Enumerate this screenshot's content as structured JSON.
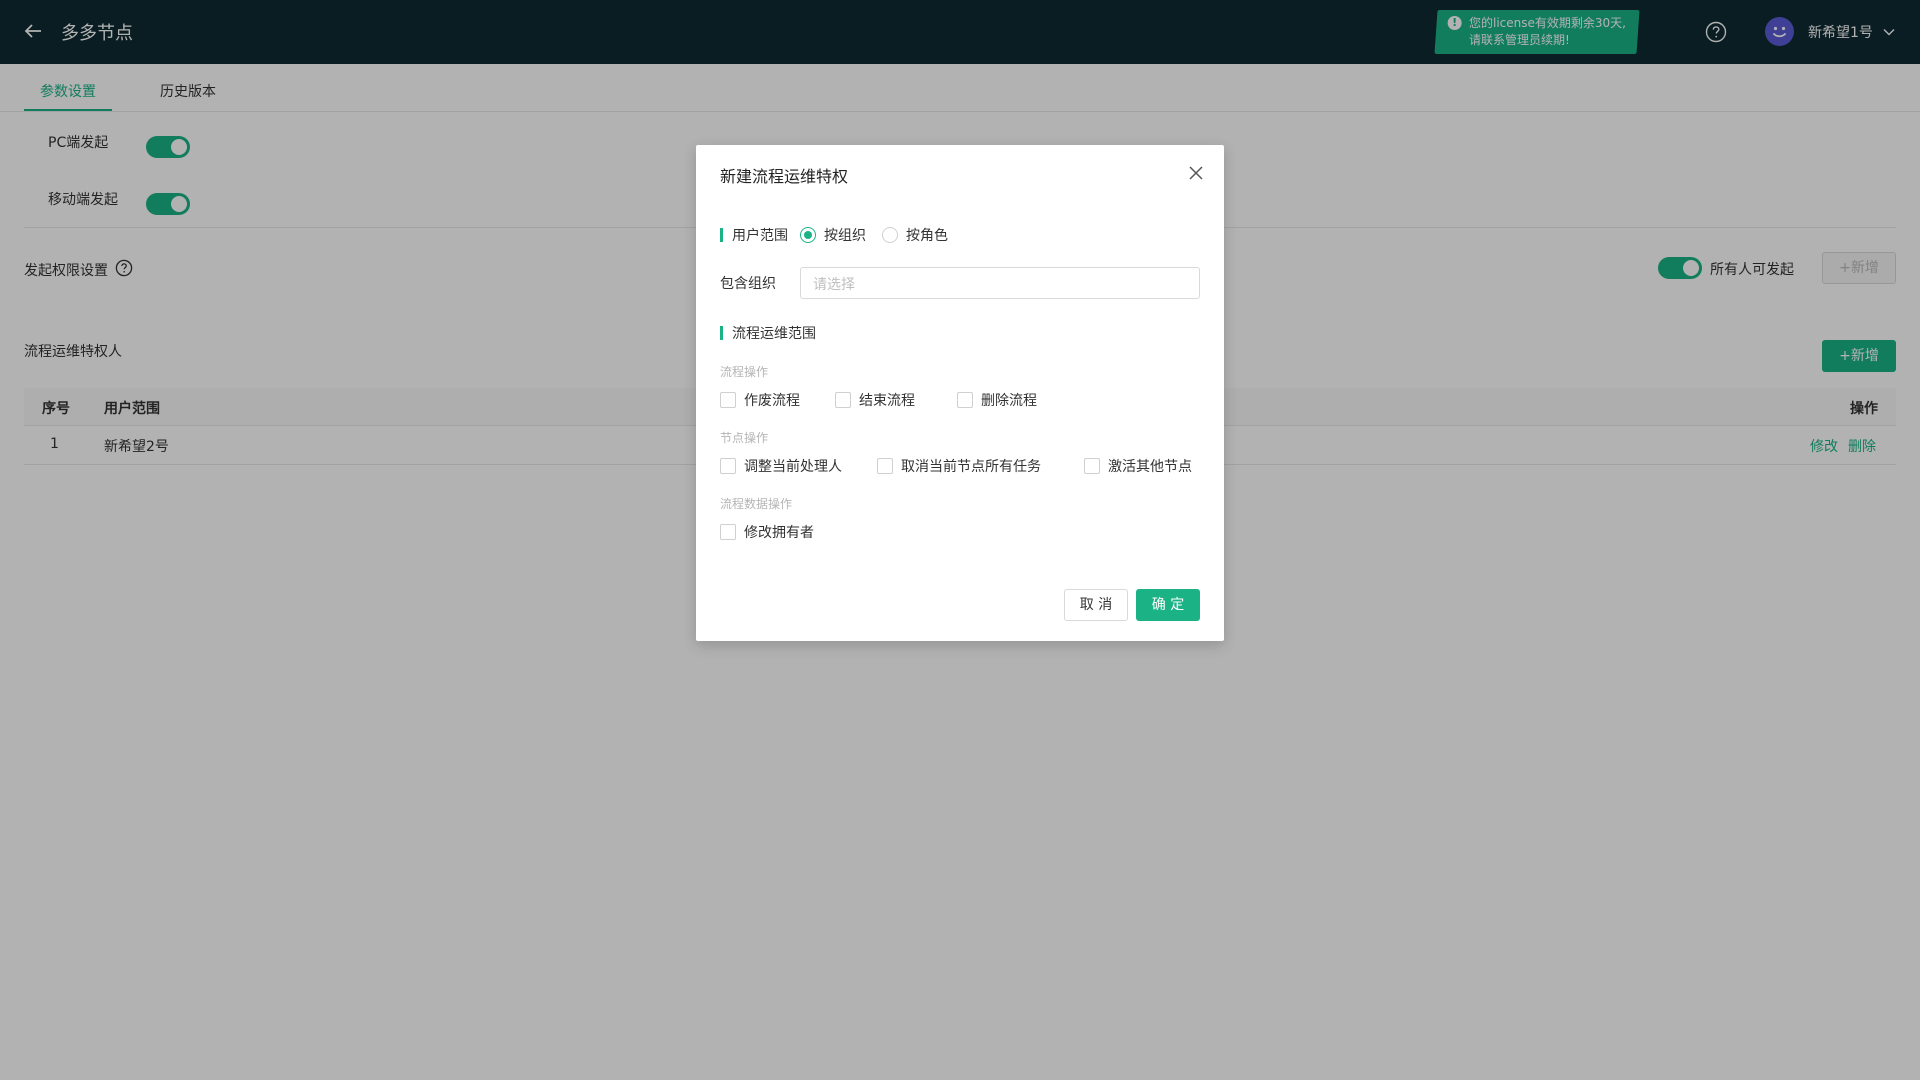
{
  "header": {
    "title": "多多节点",
    "license_notice_line1": "您的license有效期剩余30天,",
    "license_notice_line2": "请联系管理员续期!",
    "user_name": "新希望1号"
  },
  "tabs": [
    {
      "label": "参数设置",
      "active": true
    },
    {
      "label": "历史版本",
      "active": false
    }
  ],
  "settings": {
    "pc_launch_label": "PC端发起",
    "mobile_launch_label": "移动端发起",
    "permission_title": "发起权限设置",
    "everyone_can_launch_label": "所有人可发起",
    "add_label": "+新增"
  },
  "maintainers": {
    "title": "流程运维特权人",
    "add_label": "+新增",
    "columns": [
      "序号",
      "用户范围",
      "操作"
    ],
    "rows": [
      {
        "index": "1",
        "scope": "新希望2号",
        "edit": "修改",
        "delete": "删除"
      }
    ]
  },
  "modal": {
    "title": "新建流程运维特权",
    "user_scope_label": "用户范围",
    "radio_options": [
      "按组织",
      "按角色"
    ],
    "selected_radio": "按组织",
    "include_org_label": "包含组织",
    "include_org_placeholder": "请选择",
    "scope_section_label": "流程运维范围",
    "groups": [
      {
        "caption": "流程操作",
        "options": [
          "作废流程",
          "结束流程",
          "删除流程"
        ]
      },
      {
        "caption": "节点操作",
        "options": [
          "调整当前处理人",
          "取消当前节点所有任务",
          "激活其他节点"
        ]
      },
      {
        "caption": "流程数据操作",
        "options": [
          "修改拥有者"
        ]
      }
    ],
    "cancel_label": "取 消",
    "ok_label": "确 定"
  },
  "colors": {
    "accent": "#1bb386",
    "header_bg": "#0e2a33"
  }
}
